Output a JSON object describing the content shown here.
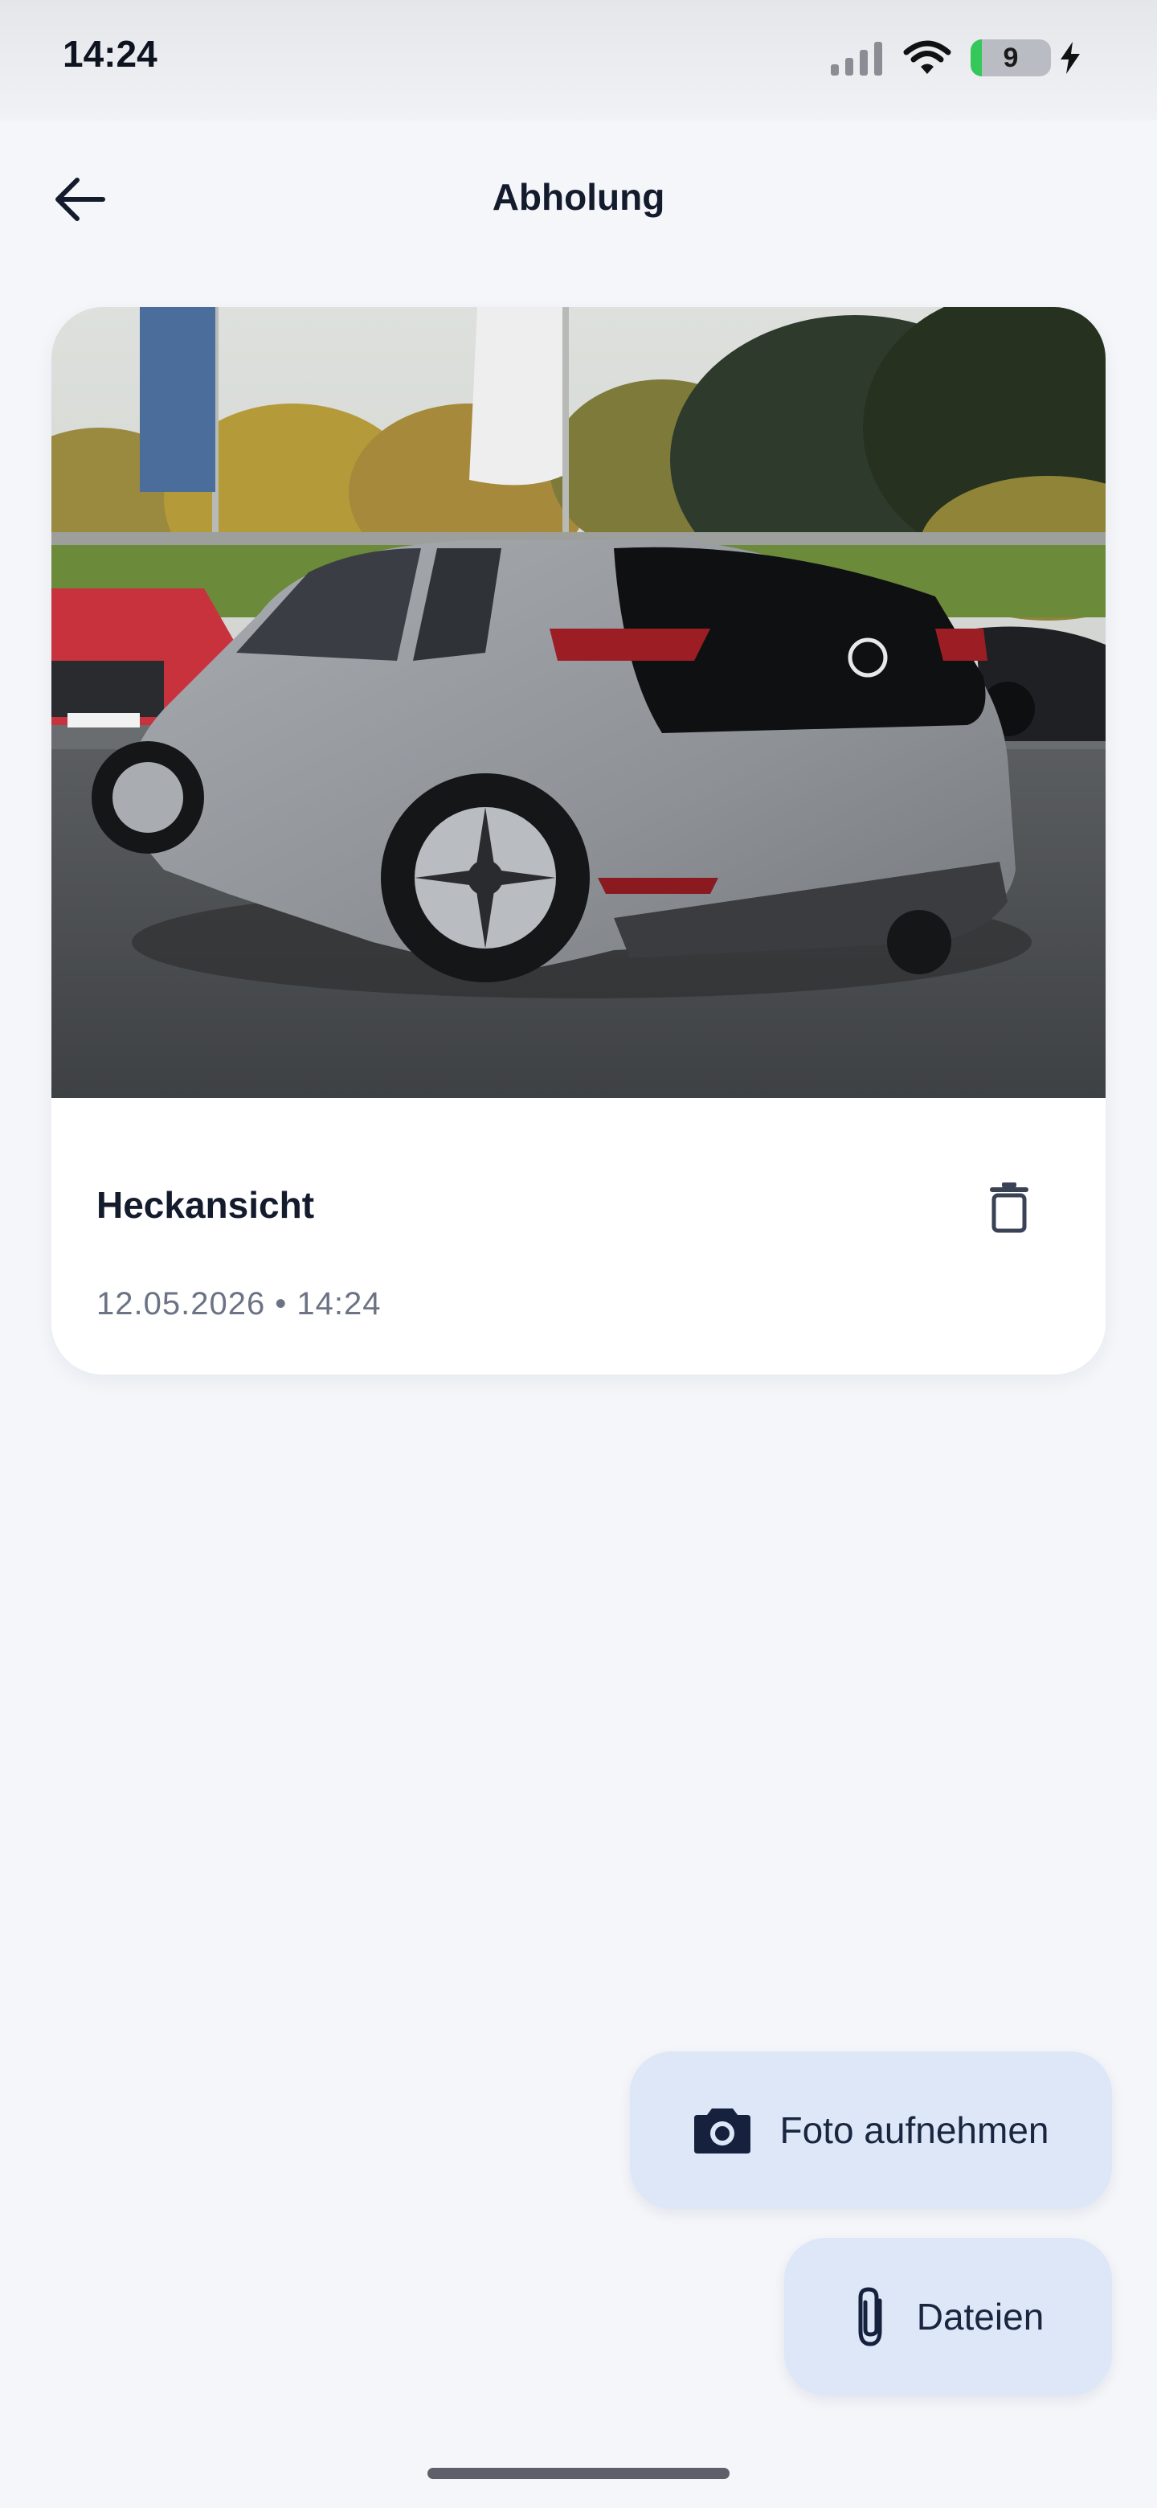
{
  "status_bar": {
    "time": "14:24",
    "battery_level": "9",
    "icons": [
      "cellular-signal-icon",
      "wifi-icon",
      "battery-icon",
      "charging-bolt-icon"
    ]
  },
  "header": {
    "title": "Abholung",
    "back_icon": "arrow-left-icon"
  },
  "card": {
    "label": "Heckansicht",
    "date": "12.05.2026 • 14:24",
    "delete_icon": "trash-icon"
  },
  "actions": {
    "take_photo": {
      "label": "Foto aufnehmen",
      "icon": "camera-icon"
    },
    "files": {
      "label": "Dateien",
      "icon": "paperclip-icon"
    }
  },
  "colors": {
    "background": "#f4f6fa",
    "fab_background": "#dde7f8",
    "text_primary": "#141b2d",
    "text_secondary": "#6b7384",
    "battery_fill": "#34c759"
  }
}
